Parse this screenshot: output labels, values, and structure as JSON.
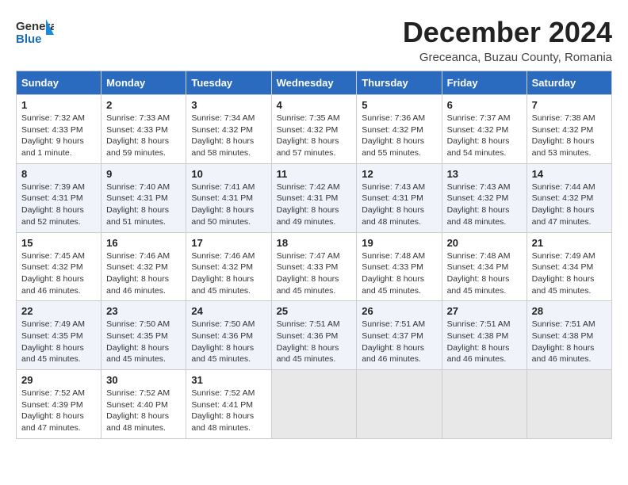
{
  "header": {
    "logo_line1": "General",
    "logo_line2": "Blue",
    "title": "December 2024",
    "subtitle": "Greceanca, Buzau County, Romania"
  },
  "days_of_week": [
    "Sunday",
    "Monday",
    "Tuesday",
    "Wednesday",
    "Thursday",
    "Friday",
    "Saturday"
  ],
  "weeks": [
    [
      {
        "day": "1",
        "detail": "Sunrise: 7:32 AM\nSunset: 4:33 PM\nDaylight: 9 hours\nand 1 minute."
      },
      {
        "day": "2",
        "detail": "Sunrise: 7:33 AM\nSunset: 4:33 PM\nDaylight: 8 hours\nand 59 minutes."
      },
      {
        "day": "3",
        "detail": "Sunrise: 7:34 AM\nSunset: 4:32 PM\nDaylight: 8 hours\nand 58 minutes."
      },
      {
        "day": "4",
        "detail": "Sunrise: 7:35 AM\nSunset: 4:32 PM\nDaylight: 8 hours\nand 57 minutes."
      },
      {
        "day": "5",
        "detail": "Sunrise: 7:36 AM\nSunset: 4:32 PM\nDaylight: 8 hours\nand 55 minutes."
      },
      {
        "day": "6",
        "detail": "Sunrise: 7:37 AM\nSunset: 4:32 PM\nDaylight: 8 hours\nand 54 minutes."
      },
      {
        "day": "7",
        "detail": "Sunrise: 7:38 AM\nSunset: 4:32 PM\nDaylight: 8 hours\nand 53 minutes."
      }
    ],
    [
      {
        "day": "8",
        "detail": "Sunrise: 7:39 AM\nSunset: 4:31 PM\nDaylight: 8 hours\nand 52 minutes."
      },
      {
        "day": "9",
        "detail": "Sunrise: 7:40 AM\nSunset: 4:31 PM\nDaylight: 8 hours\nand 51 minutes."
      },
      {
        "day": "10",
        "detail": "Sunrise: 7:41 AM\nSunset: 4:31 PM\nDaylight: 8 hours\nand 50 minutes."
      },
      {
        "day": "11",
        "detail": "Sunrise: 7:42 AM\nSunset: 4:31 PM\nDaylight: 8 hours\nand 49 minutes."
      },
      {
        "day": "12",
        "detail": "Sunrise: 7:43 AM\nSunset: 4:31 PM\nDaylight: 8 hours\nand 48 minutes."
      },
      {
        "day": "13",
        "detail": "Sunrise: 7:43 AM\nSunset: 4:32 PM\nDaylight: 8 hours\nand 48 minutes."
      },
      {
        "day": "14",
        "detail": "Sunrise: 7:44 AM\nSunset: 4:32 PM\nDaylight: 8 hours\nand 47 minutes."
      }
    ],
    [
      {
        "day": "15",
        "detail": "Sunrise: 7:45 AM\nSunset: 4:32 PM\nDaylight: 8 hours\nand 46 minutes."
      },
      {
        "day": "16",
        "detail": "Sunrise: 7:46 AM\nSunset: 4:32 PM\nDaylight: 8 hours\nand 46 minutes."
      },
      {
        "day": "17",
        "detail": "Sunrise: 7:46 AM\nSunset: 4:32 PM\nDaylight: 8 hours\nand 45 minutes."
      },
      {
        "day": "18",
        "detail": "Sunrise: 7:47 AM\nSunset: 4:33 PM\nDaylight: 8 hours\nand 45 minutes."
      },
      {
        "day": "19",
        "detail": "Sunrise: 7:48 AM\nSunset: 4:33 PM\nDaylight: 8 hours\nand 45 minutes."
      },
      {
        "day": "20",
        "detail": "Sunrise: 7:48 AM\nSunset: 4:34 PM\nDaylight: 8 hours\nand 45 minutes."
      },
      {
        "day": "21",
        "detail": "Sunrise: 7:49 AM\nSunset: 4:34 PM\nDaylight: 8 hours\nand 45 minutes."
      }
    ],
    [
      {
        "day": "22",
        "detail": "Sunrise: 7:49 AM\nSunset: 4:35 PM\nDaylight: 8 hours\nand 45 minutes."
      },
      {
        "day": "23",
        "detail": "Sunrise: 7:50 AM\nSunset: 4:35 PM\nDaylight: 8 hours\nand 45 minutes."
      },
      {
        "day": "24",
        "detail": "Sunrise: 7:50 AM\nSunset: 4:36 PM\nDaylight: 8 hours\nand 45 minutes."
      },
      {
        "day": "25",
        "detail": "Sunrise: 7:51 AM\nSunset: 4:36 PM\nDaylight: 8 hours\nand 45 minutes."
      },
      {
        "day": "26",
        "detail": "Sunrise: 7:51 AM\nSunset: 4:37 PM\nDaylight: 8 hours\nand 46 minutes."
      },
      {
        "day": "27",
        "detail": "Sunrise: 7:51 AM\nSunset: 4:38 PM\nDaylight: 8 hours\nand 46 minutes."
      },
      {
        "day": "28",
        "detail": "Sunrise: 7:51 AM\nSunset: 4:38 PM\nDaylight: 8 hours\nand 46 minutes."
      }
    ],
    [
      {
        "day": "29",
        "detail": "Sunrise: 7:52 AM\nSunset: 4:39 PM\nDaylight: 8 hours\nand 47 minutes."
      },
      {
        "day": "30",
        "detail": "Sunrise: 7:52 AM\nSunset: 4:40 PM\nDaylight: 8 hours\nand 48 minutes."
      },
      {
        "day": "31",
        "detail": "Sunrise: 7:52 AM\nSunset: 4:41 PM\nDaylight: 8 hours\nand 48 minutes."
      },
      {
        "day": "",
        "detail": ""
      },
      {
        "day": "",
        "detail": ""
      },
      {
        "day": "",
        "detail": ""
      },
      {
        "day": "",
        "detail": ""
      }
    ]
  ]
}
